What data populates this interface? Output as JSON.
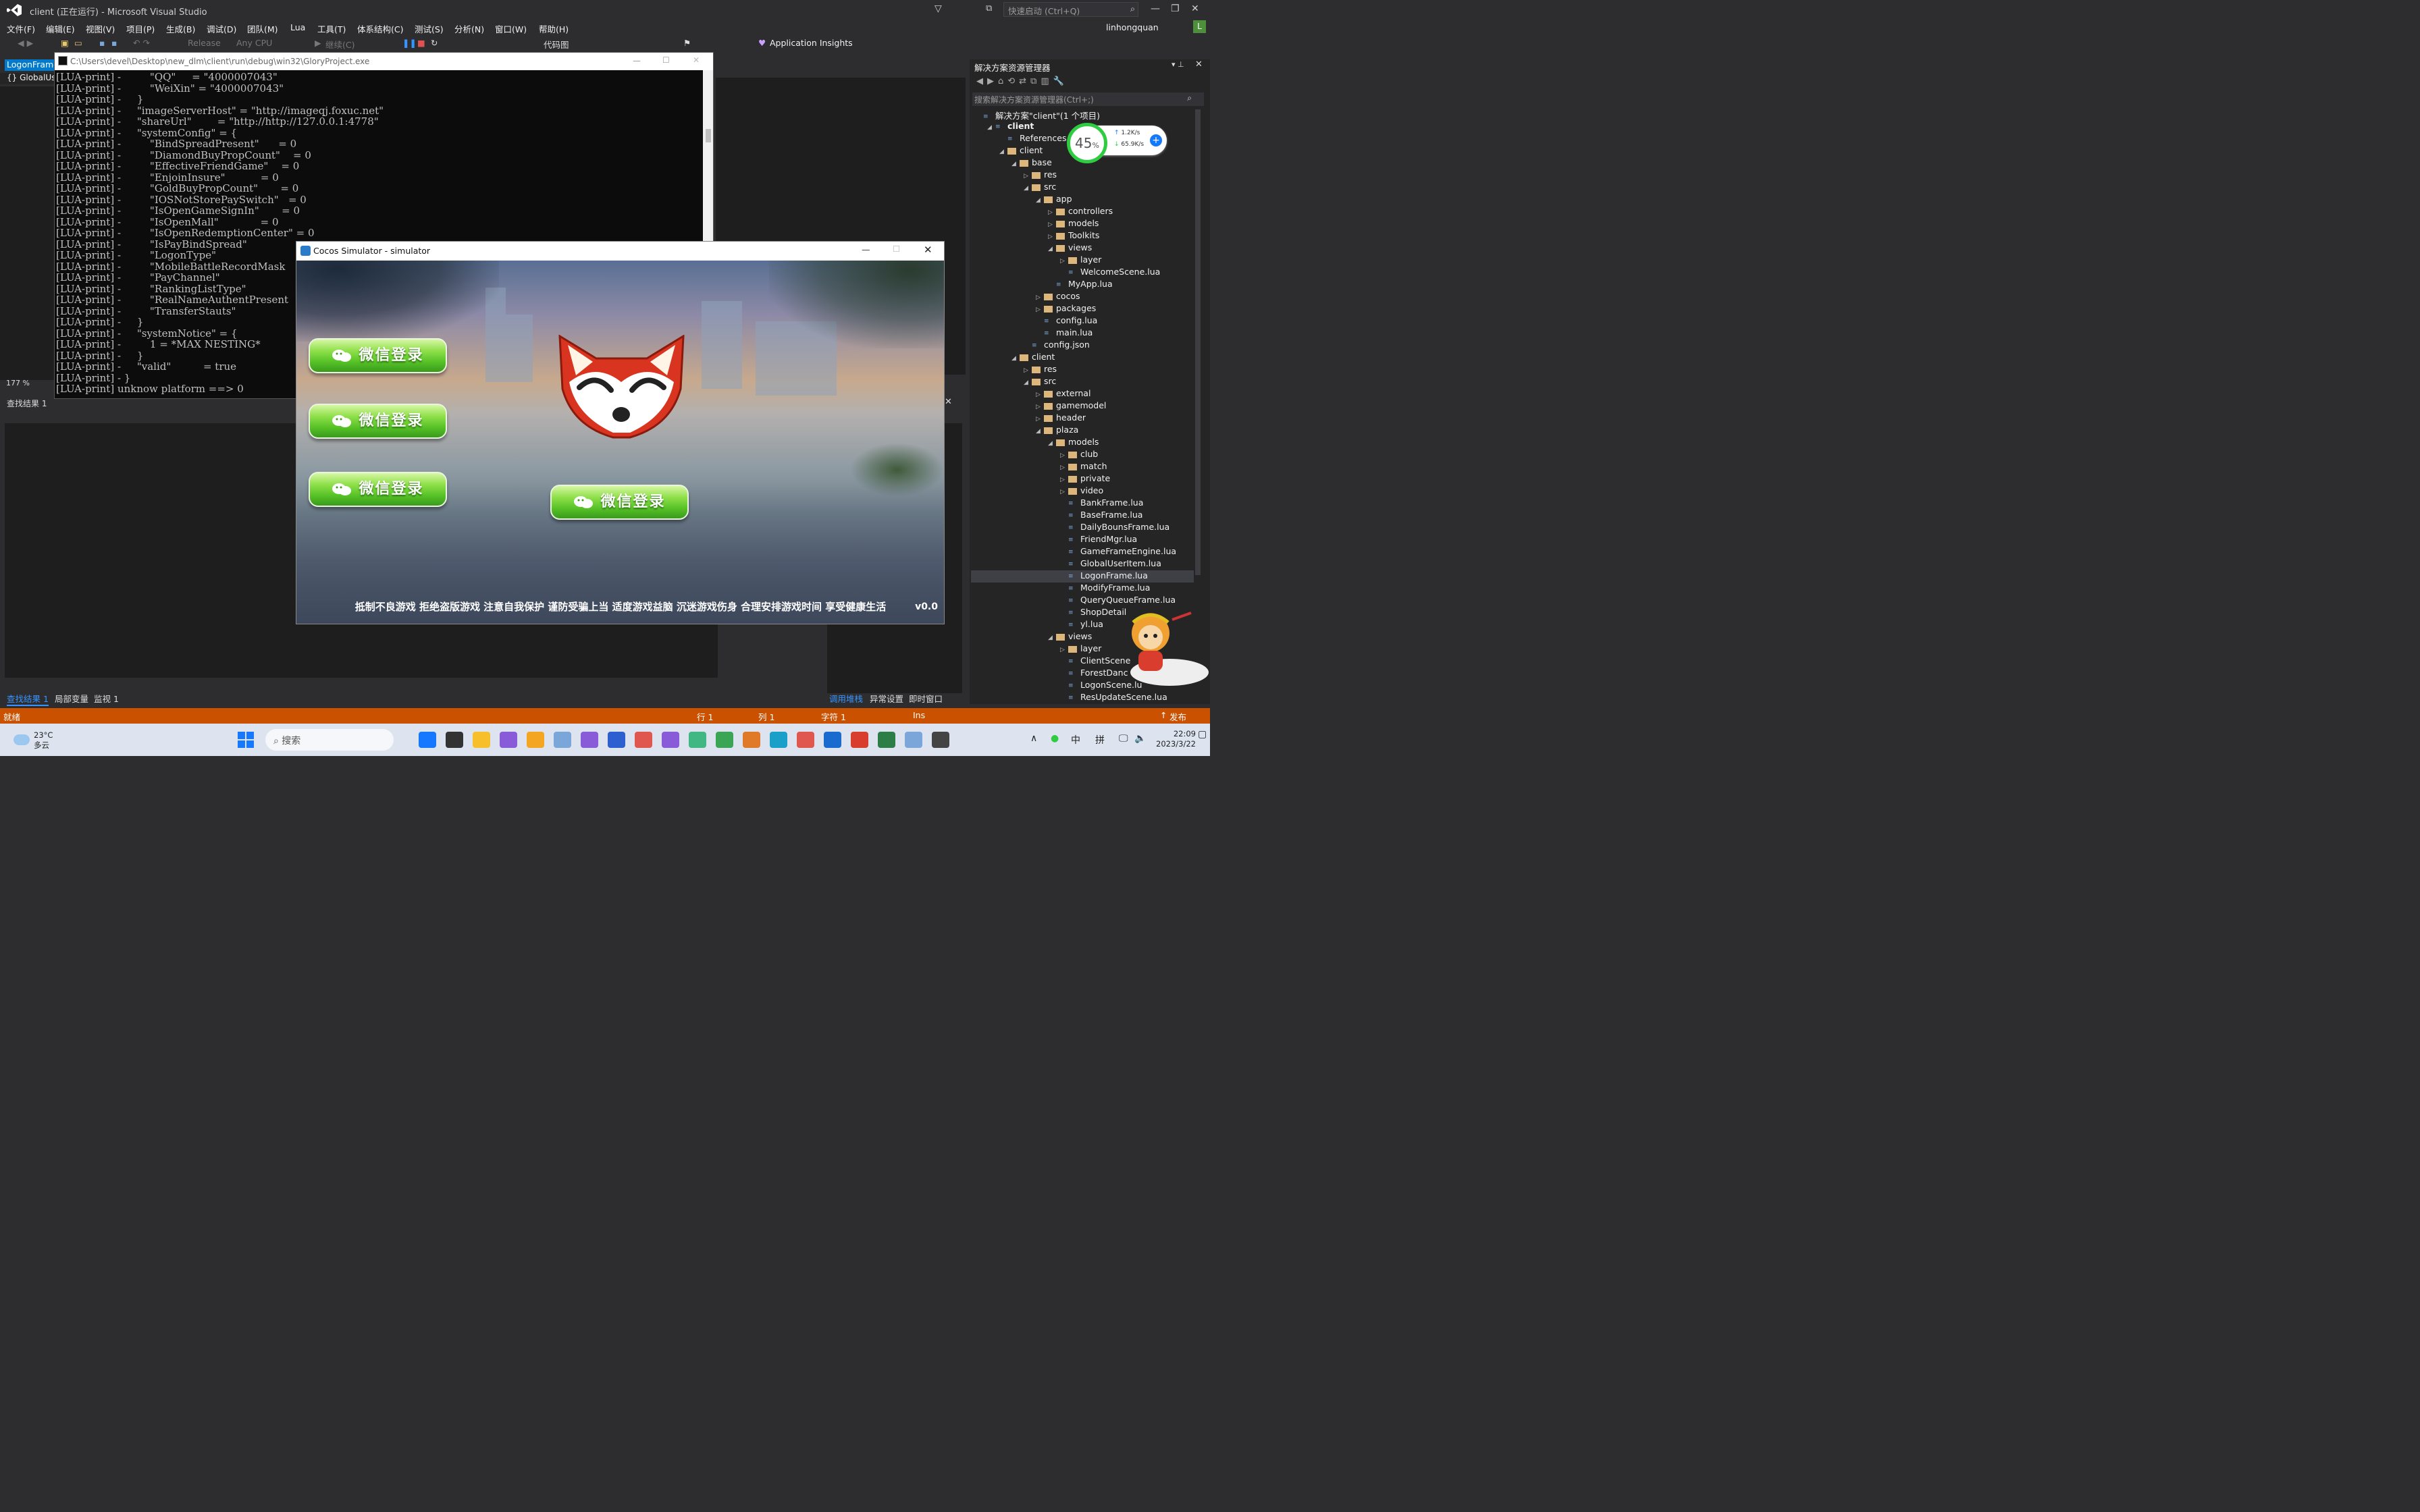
{
  "vs": {
    "title": "client (正在运行) - Microsoft Visual Studio",
    "quick_launch": "快速启动 (Ctrl+Q)",
    "user": "linhongquan",
    "avatar": "L",
    "menus": [
      "文件(F)",
      "编辑(E)",
      "视图(V)",
      "项目(P)",
      "生成(B)",
      "调试(D)",
      "团队(M)",
      "Lua",
      "工具(T)",
      "体系结构(C)",
      "测试(S)",
      "分析(N)",
      "窗口(W)",
      "帮助(H)"
    ],
    "toolbar": {
      "config": "Release",
      "platform": "Any CPU",
      "continue": "继续(C)",
      "code_map": "代码图",
      "insights": "Application Insights"
    },
    "editor_tab": "LogonFrame",
    "editor_nav": "{} GlobalUs",
    "zoom": "177 %",
    "find_title": "查找结果 1",
    "bottom_tabs": [
      "查找结果 1",
      "局部变量",
      "监视 1"
    ],
    "right_tabs": [
      "调用堆栈",
      "异常设置",
      "即时窗口"
    ]
  },
  "console": {
    "path": "C:\\Users\\devel\\Desktop\\new_dlm\\client\\run\\debug\\win32\\GloryProject.exe",
    "lines": [
      "[LUA-print] -         \"QQ\"     = \"4000007043\"",
      "[LUA-print] -         \"WeiXin\" = \"4000007043\"",
      "[LUA-print] -     }",
      "[LUA-print] -     \"imageServerHost\" = \"http://imageqj.foxuc.net\"",
      "[LUA-print] -     \"shareUrl\"        = \"http://http://127.0.0.1:4778\"",
      "[LUA-print] -     \"systemConfig\" = {",
      "[LUA-print] -         \"BindSpreadPresent\"      = 0",
      "[LUA-print] -         \"DiamondBuyPropCount\"    = 0",
      "[LUA-print] -         \"EffectiveFriendGame\"    = 0",
      "[LUA-print] -         \"EnjoinInsure\"           = 0",
      "[LUA-print] -         \"GoldBuyPropCount\"       = 0",
      "[LUA-print] -         \"IOSNotStorePaySwitch\"   = 0",
      "[LUA-print] -         \"IsOpenGameSignIn\"       = 0",
      "[LUA-print] -         \"IsOpenMall\"             = 0",
      "[LUA-print] -         \"IsOpenRedemptionCenter\" = 0",
      "[LUA-print] -         \"IsPayBindSpread\"",
      "[LUA-print] -         \"LogonType\"",
      "[LUA-print] -         \"MobileBattleRecordMask",
      "[LUA-print] -         \"PayChannel\"",
      "[LUA-print] -         \"RankingListType\"",
      "[LUA-print] -         \"RealNameAuthentPresent",
      "[LUA-print] -         \"TransferStauts\"",
      "[LUA-print] -     }",
      "[LUA-print] -     \"systemNotice\" = {",
      "[LUA-print] -         1 = *MAX NESTING*",
      "[LUA-print] -     }",
      "[LUA-print] -     \"valid\"          = true",
      "[LUA-print] - }",
      "[LUA-print] unknow platform ==> 0"
    ]
  },
  "simulator": {
    "title": "Cocos Simulator - simulator",
    "login_label": "微信登录",
    "slogan": "抵制不良游戏 拒绝盗版游戏 注意自我保护 谨防受骗上当 适度游戏益脑 沉迷游戏伤身 合理安排游戏时间 享受健康生活",
    "version": "v0.0"
  },
  "solution": {
    "header": "解决方案资源管理器",
    "search": "搜索解决方案资源管理器(Ctrl+;)",
    "net": {
      "percent": "45",
      "up": "1.2K/s",
      "down": "65.9K/s"
    },
    "tree": [
      {
        "label": "解决方案\"client\"(1 个项目)",
        "lvl": 0,
        "kind": "sol",
        "tri": ""
      },
      {
        "label": "client",
        "lvl": 1,
        "kind": "proj",
        "tri": "◢"
      },
      {
        "label": "References",
        "lvl": 2,
        "kind": "ref",
        "tri": ""
      },
      {
        "label": "client",
        "lvl": 2,
        "kind": "folder",
        "tri": "◢"
      },
      {
        "label": "base",
        "lvl": 3,
        "kind": "folder",
        "tri": "◢"
      },
      {
        "label": "res",
        "lvl": 4,
        "kind": "folder",
        "tri": "▷"
      },
      {
        "label": "src",
        "lvl": 4,
        "kind": "folder",
        "tri": "◢"
      },
      {
        "label": "app",
        "lvl": 5,
        "kind": "folder",
        "tri": "◢"
      },
      {
        "label": "controllers",
        "lvl": 6,
        "kind": "folder",
        "tri": "▷"
      },
      {
        "label": "models",
        "lvl": 6,
        "kind": "folder",
        "tri": "▷"
      },
      {
        "label": "Toolkits",
        "lvl": 6,
        "kind": "folder",
        "tri": "▷"
      },
      {
        "label": "views",
        "lvl": 6,
        "kind": "folder",
        "tri": "◢"
      },
      {
        "label": "layer",
        "lvl": 7,
        "kind": "folder",
        "tri": "▷"
      },
      {
        "label": "WelcomeScene.lua",
        "lvl": 7,
        "kind": "lua",
        "tri": ""
      },
      {
        "label": "MyApp.lua",
        "lvl": 6,
        "kind": "lua",
        "tri": ""
      },
      {
        "label": "cocos",
        "lvl": 5,
        "kind": "folder",
        "tri": "▷"
      },
      {
        "label": "packages",
        "lvl": 5,
        "kind": "folder",
        "tri": "▷"
      },
      {
        "label": "config.lua",
        "lvl": 5,
        "kind": "lua",
        "tri": ""
      },
      {
        "label": "main.lua",
        "lvl": 5,
        "kind": "lua",
        "tri": ""
      },
      {
        "label": "config.json",
        "lvl": 4,
        "kind": "json",
        "tri": ""
      },
      {
        "label": "client",
        "lvl": 3,
        "kind": "folder",
        "tri": "◢"
      },
      {
        "label": "res",
        "lvl": 4,
        "kind": "folder",
        "tri": "▷"
      },
      {
        "label": "src",
        "lvl": 4,
        "kind": "folder",
        "tri": "◢"
      },
      {
        "label": "external",
        "lvl": 5,
        "kind": "folder",
        "tri": "▷"
      },
      {
        "label": "gamemodel",
        "lvl": 5,
        "kind": "folder",
        "tri": "▷"
      },
      {
        "label": "header",
        "lvl": 5,
        "kind": "folder",
        "tri": "▷"
      },
      {
        "label": "plaza",
        "lvl": 5,
        "kind": "folder",
        "tri": "◢"
      },
      {
        "label": "models",
        "lvl": 6,
        "kind": "folder",
        "tri": "◢"
      },
      {
        "label": "club",
        "lvl": 7,
        "kind": "folder",
        "tri": "▷"
      },
      {
        "label": "match",
        "lvl": 7,
        "kind": "folder",
        "tri": "▷"
      },
      {
        "label": "private",
        "lvl": 7,
        "kind": "folder",
        "tri": "▷"
      },
      {
        "label": "video",
        "lvl": 7,
        "kind": "folder",
        "tri": "▷"
      },
      {
        "label": "BankFrame.lua",
        "lvl": 7,
        "kind": "lua",
        "tri": ""
      },
      {
        "label": "BaseFrame.lua",
        "lvl": 7,
        "kind": "lua",
        "tri": ""
      },
      {
        "label": "DailyBounsFrame.lua",
        "lvl": 7,
        "kind": "lua",
        "tri": ""
      },
      {
        "label": "FriendMgr.lua",
        "lvl": 7,
        "kind": "lua",
        "tri": ""
      },
      {
        "label": "GameFrameEngine.lua",
        "lvl": 7,
        "kind": "lua",
        "tri": ""
      },
      {
        "label": "GlobalUserItem.lua",
        "lvl": 7,
        "kind": "lua",
        "tri": ""
      },
      {
        "label": "LogonFrame.lua",
        "lvl": 7,
        "kind": "lua",
        "tri": ""
      },
      {
        "label": "ModifyFrame.lua",
        "lvl": 7,
        "kind": "lua",
        "tri": ""
      },
      {
        "label": "QueryQueueFrame.lua",
        "lvl": 7,
        "kind": "lua",
        "tri": ""
      },
      {
        "label": "ShopDetail",
        "lvl": 7,
        "kind": "lua",
        "tri": ""
      },
      {
        "label": "yl.lua",
        "lvl": 7,
        "kind": "lua",
        "tri": ""
      },
      {
        "label": "views",
        "lvl": 6,
        "kind": "folder",
        "tri": "◢"
      },
      {
        "label": "layer",
        "lvl": 7,
        "kind": "folder",
        "tri": "▷"
      },
      {
        "label": "ClientScene",
        "lvl": 7,
        "kind": "lua",
        "tri": ""
      },
      {
        "label": "ForestDanc",
        "lvl": 7,
        "kind": "lua",
        "tri": ""
      },
      {
        "label": "LogonScene.lu",
        "lvl": 7,
        "kind": "lua",
        "tri": ""
      },
      {
        "label": "ResUpdateScene.lua",
        "lvl": 7,
        "kind": "lua",
        "tri": ""
      }
    ]
  },
  "status": {
    "ready": "就绪",
    "row": "行 1",
    "col": "列 1",
    "char": "字符 1",
    "ins": "Ins",
    "publish": "发布"
  },
  "taskbar": {
    "temp": "23°C",
    "weather": "多云",
    "search": "搜索",
    "time": "22:09",
    "date": "2023/3/22",
    "ime": "中",
    "ime2": "拼",
    "colors": [
      "#1677ff",
      "#333",
      "#f7c02b",
      "#8a5bd8",
      "#f4a623",
      "#7aa6da",
      "#8a5bd8",
      "#2d5fd0",
      "#e0574f",
      "#8a5bd8",
      "#41b883",
      "#3aa655",
      "#e07a28",
      "#1aa0c8",
      "#e0574f",
      "#1a6bd0",
      "#d93d2d",
      "#2d7d46",
      "#7aa6da",
      "#444"
    ]
  }
}
